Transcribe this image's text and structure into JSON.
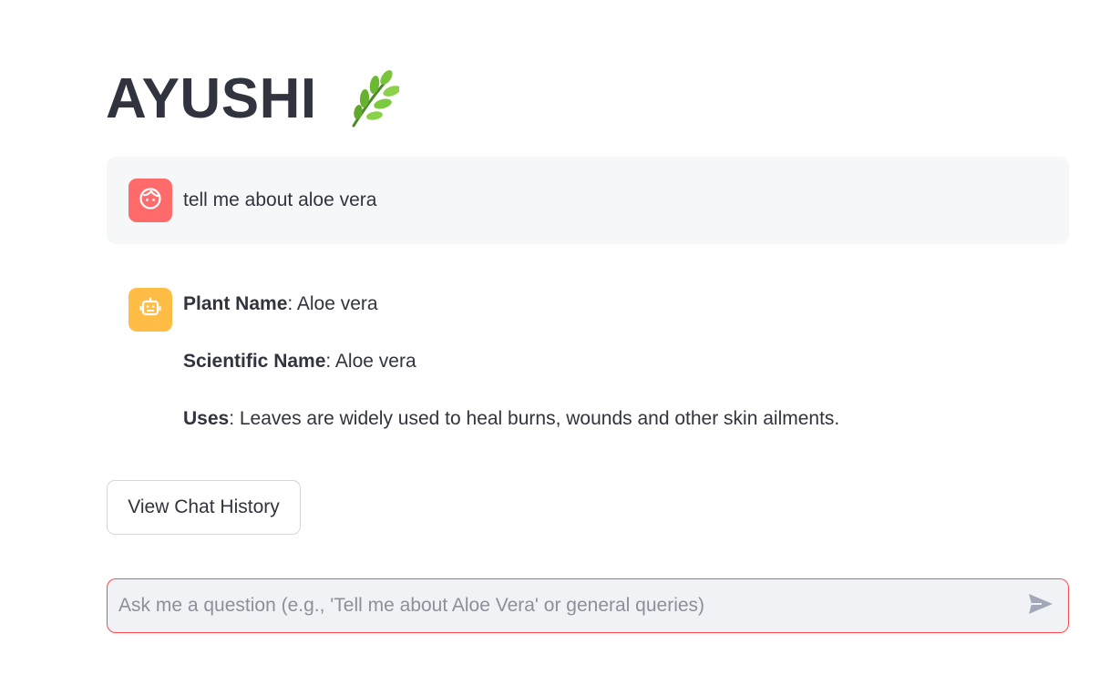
{
  "header": {
    "title": "AYUSHI",
    "title_icon": "herb-leaf-icon"
  },
  "messages": [
    {
      "role": "user",
      "avatar_icon": "user-face-icon",
      "avatar_color": "#ff6b6b",
      "text": "tell me about aloe vera"
    },
    {
      "role": "assistant",
      "avatar_icon": "robot-icon",
      "avatar_color": "#ffbd45",
      "lines": [
        {
          "label": "Plant Name",
          "value": ": Aloe vera"
        },
        {
          "label": "Scientific Name",
          "value": ": Aloe vera"
        },
        {
          "label": "Uses",
          "value": ": Leaves are widely used to heal burns, wounds and other skin ailments."
        }
      ]
    }
  ],
  "history_button": {
    "label": "View Chat History"
  },
  "chat_input": {
    "placeholder": "Ask me a question (e.g., 'Tell me about Aloe Vera' or general queries)",
    "value": "",
    "send_icon": "send-icon",
    "border_color": "#ff4b4b"
  }
}
